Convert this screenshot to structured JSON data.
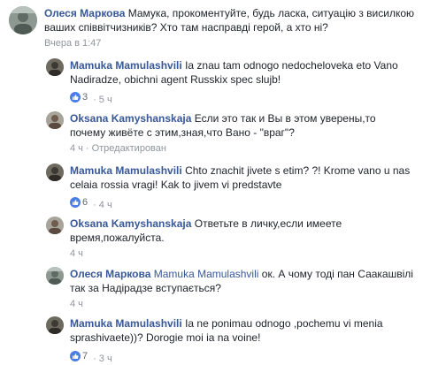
{
  "comments": [
    {
      "author": "Олеся Маркова",
      "mention": "",
      "text_lines": [
        "Мамука, прокоментуйте, будь ласка, ситуацію з висилкою",
        "ваших співвітчизників? Хто там насправді герой, а хто ні?"
      ],
      "reactions": "",
      "time": "Вчера в 1:47",
      "edited": ""
    },
    {
      "author": "Mamuka Mamulashvili",
      "mention": "",
      "text_lines": [
        "Ia znau tam odnogo nedocheloveka eto Vano",
        "Nadiradze, obichni agent Russkix spec slujb!"
      ],
      "reactions": "3",
      "time": "5 ч",
      "edited": ""
    },
    {
      "author": "Oksana Kamyshanskaja",
      "mention": "",
      "text_lines": [
        "Если это так и Вы в этом уверены,то",
        "почему живёте с этим,зная,что Вано - \"враг\"?"
      ],
      "reactions": "",
      "time": "4 ч",
      "edited": "Отредактирован"
    },
    {
      "author": "Mamuka Mamulashvili",
      "mention": "",
      "text_lines": [
        "Chto znachit jivete s etim? ?! Krome vano u nas",
        "celaia rossia vragi! Kak to jivem vi predstavte"
      ],
      "reactions": "6",
      "time": "4 ч",
      "edited": ""
    },
    {
      "author": "Oksana Kamyshanskaja",
      "mention": "",
      "text_lines": [
        "Ответьте в личку,если имеете",
        "время,пожалуйста."
      ],
      "reactions": "",
      "time": "4 ч",
      "edited": ""
    },
    {
      "author": "Олеся Маркова",
      "mention": "Mamuka Mamulashvili",
      "text_lines": [
        "ок. А чому тоді пан Саакашвілі",
        "так за Надірадзе вступається?"
      ],
      "reactions": "",
      "time": "4 ч",
      "edited": ""
    },
    {
      "author": "Mamuka Mamulashvili",
      "mention": "",
      "text_lines": [
        "Ia ne ponimau odnogo ,pochemu vi menia",
        "sprashivaete))? Dorogie moi ia na voine!"
      ],
      "reactions": "7",
      "time": "3 ч",
      "edited": ""
    }
  ]
}
